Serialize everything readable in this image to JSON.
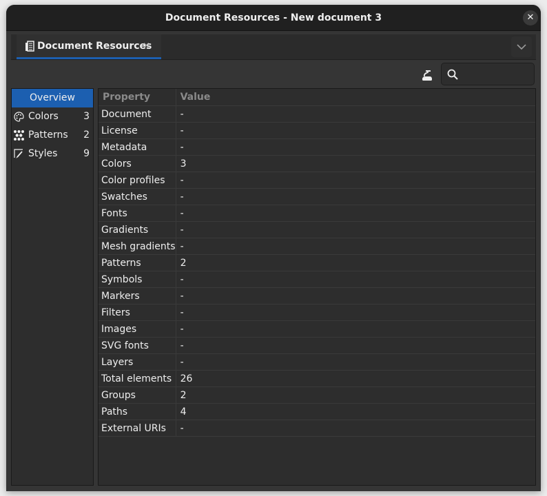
{
  "window": {
    "title": "Document Resources - New document 3",
    "close_icon": "close-icon"
  },
  "tabs": [
    {
      "label": "Document Resources",
      "icon": "document-resources-icon",
      "close": "×",
      "active": true
    }
  ],
  "tab_menu_icon": "chevron-down-icon",
  "toolbar": {
    "clean_icon": "vacuum-cleaner-icon",
    "search": {
      "value": "",
      "placeholder": "",
      "icon": "search-icon"
    }
  },
  "sidebar": {
    "items": [
      {
        "label": "Overview",
        "count": "",
        "icon": "",
        "active": true
      },
      {
        "label": "Colors",
        "count": "3",
        "icon": "palette-icon"
      },
      {
        "label": "Patterns",
        "count": "2",
        "icon": "pattern-icon"
      },
      {
        "label": "Styles",
        "count": "9",
        "icon": "style-brush-icon"
      }
    ]
  },
  "table": {
    "columns": [
      "Property",
      "Value"
    ],
    "rows": [
      {
        "property": "Document",
        "value": "-"
      },
      {
        "property": "License",
        "value": "-"
      },
      {
        "property": "Metadata",
        "value": "-"
      },
      {
        "property": "Colors",
        "value": "3"
      },
      {
        "property": "Color profiles",
        "value": "-"
      },
      {
        "property": "Swatches",
        "value": "-"
      },
      {
        "property": "Fonts",
        "value": "-"
      },
      {
        "property": "Gradients",
        "value": "-"
      },
      {
        "property": "Mesh gradients",
        "value": "-"
      },
      {
        "property": "Patterns",
        "value": "2"
      },
      {
        "property": "Symbols",
        "value": "-"
      },
      {
        "property": "Markers",
        "value": "-"
      },
      {
        "property": "Filters",
        "value": "-"
      },
      {
        "property": "Images",
        "value": "-"
      },
      {
        "property": "SVG fonts",
        "value": "-"
      },
      {
        "property": "Layers",
        "value": "-"
      },
      {
        "property": "Total elements",
        "value": "26"
      },
      {
        "property": "Groups",
        "value": "2"
      },
      {
        "property": "Paths",
        "value": "4"
      },
      {
        "property": "External URIs",
        "value": "-"
      }
    ]
  },
  "colors": {
    "accent": "#1c5fb0",
    "titlebar": "#202020",
    "panel": "#2d2d2d"
  }
}
